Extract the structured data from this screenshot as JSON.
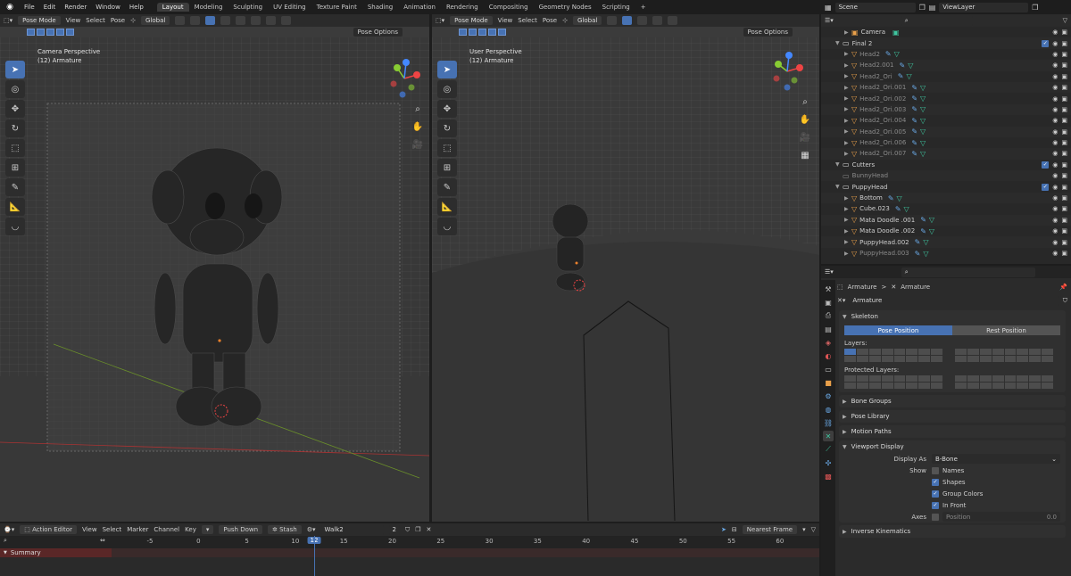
{
  "topbar": {
    "menus": [
      "File",
      "Edit",
      "Render",
      "Window",
      "Help"
    ],
    "workspaces": [
      "Layout",
      "Modeling",
      "Sculpting",
      "UV Editing",
      "Texture Paint",
      "Shading",
      "Animation",
      "Rendering",
      "Compositing",
      "Geometry Nodes",
      "Scripting"
    ],
    "active_workspace": "Layout",
    "add_tab": "+",
    "scene": "Scene",
    "view_layer": "ViewLayer"
  },
  "left_viewport": {
    "mode": "Pose Mode",
    "menus": [
      "View",
      "Select",
      "Pose"
    ],
    "orientation": "Global",
    "options": "Pose Options",
    "label_line1": "Camera Perspective",
    "label_line2": "(12) Armature"
  },
  "right_viewport": {
    "mode": "Pose Mode",
    "menus": [
      "View",
      "Select",
      "Pose"
    ],
    "orientation": "Global",
    "options": "Pose Options",
    "label_line1": "User Perspective",
    "label_line2": "(12) Armature"
  },
  "outliner": {
    "rows": [
      {
        "name": "Camera",
        "indent": 1,
        "kind": "camera"
      },
      {
        "name": "Final 2",
        "indent": 0,
        "kind": "collection",
        "check": true
      },
      {
        "name": "Head2",
        "indent": 1,
        "kind": "obj",
        "dim": true
      },
      {
        "name": "Head2.001",
        "indent": 1,
        "kind": "obj",
        "dim": true
      },
      {
        "name": "Head2_Ori",
        "indent": 1,
        "kind": "obj",
        "dim": true
      },
      {
        "name": "Head2_Ori.001",
        "indent": 1,
        "kind": "obj",
        "dim": true
      },
      {
        "name": "Head2_Ori.002",
        "indent": 1,
        "kind": "obj",
        "dim": true
      },
      {
        "name": "Head2_Ori.003",
        "indent": 1,
        "kind": "obj",
        "dim": true
      },
      {
        "name": "Head2_Ori.004",
        "indent": 1,
        "kind": "obj",
        "dim": true
      },
      {
        "name": "Head2_Ori.005",
        "indent": 1,
        "kind": "obj",
        "dim": true
      },
      {
        "name": "Head2_Ori.006",
        "indent": 1,
        "kind": "obj",
        "dim": true
      },
      {
        "name": "Head2_Ori.007",
        "indent": 1,
        "kind": "obj",
        "dim": true
      },
      {
        "name": "Cutters",
        "indent": 0,
        "kind": "collection",
        "check": true
      },
      {
        "name": "BunnyHead",
        "indent": 0,
        "kind": "plain",
        "dim": true
      },
      {
        "name": "PuppyHead",
        "indent": 0,
        "kind": "collection",
        "check": true
      },
      {
        "name": "Bottom",
        "indent": 1,
        "kind": "obj"
      },
      {
        "name": "Cube.023",
        "indent": 1,
        "kind": "obj"
      },
      {
        "name": "Mata Doodle .001",
        "indent": 1,
        "kind": "obj"
      },
      {
        "name": "Mata Doodle .002",
        "indent": 1,
        "kind": "obj"
      },
      {
        "name": "PuppyHead.002",
        "indent": 1,
        "kind": "obj"
      },
      {
        "name": "PuppyHead.003",
        "indent": 1,
        "kind": "obj",
        "dim": true
      }
    ]
  },
  "properties": {
    "breadcrumb_a": "Armature",
    "breadcrumb_sep": ">",
    "breadcrumb_b": "Armature",
    "datablock": "Armature",
    "skeleton": "Skeleton",
    "pose_position": "Pose Position",
    "rest_position": "Rest Position",
    "layers_label": "Layers:",
    "protected_label": "Protected Layers:",
    "bone_groups": "Bone Groups",
    "pose_library": "Pose Library",
    "motion_paths": "Motion Paths",
    "viewport_display": "Viewport Display",
    "display_as_label": "Display As",
    "display_as_value": "B-Bone",
    "show_label": "Show",
    "names": "Names",
    "shapes": "Shapes",
    "group_colors": "Group Colors",
    "in_front": "In Front",
    "axes_label": "Axes",
    "position_label": "Position",
    "position_value": "0.0",
    "inverse_kinematics": "Inverse Kinematics"
  },
  "timeline": {
    "editor": "Action Editor",
    "menus": [
      "View",
      "Select",
      "Marker",
      "Channel",
      "Key"
    ],
    "push_down": "Push Down",
    "stash": "Stash",
    "action": "Walk2",
    "users": "2",
    "snap": "Nearest Frame",
    "ticks": [
      "-5",
      "0",
      "5",
      "10",
      "15",
      "20",
      "25",
      "30",
      "35",
      "40",
      "45",
      "50",
      "55",
      "60"
    ],
    "current_frame": "12",
    "summary": "Summary"
  }
}
